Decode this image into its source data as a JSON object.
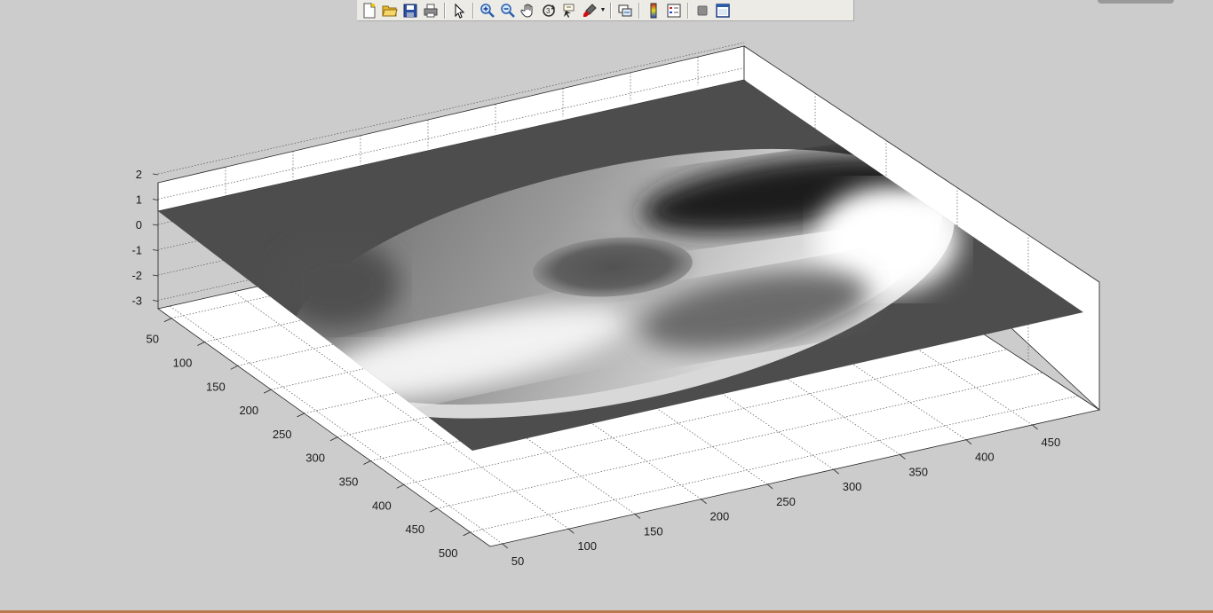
{
  "toolbar": {
    "buttons": [
      {
        "name": "new-figure-button",
        "icon": "new-document-icon"
      },
      {
        "name": "open-file-button",
        "icon": "folder-open-icon"
      },
      {
        "name": "save-figure-button",
        "icon": "floppy-disk-icon"
      },
      {
        "name": "print-figure-button",
        "icon": "printer-icon"
      },
      {
        "name": "edit-plot-button",
        "icon": "pointer-arrow-icon"
      },
      {
        "name": "zoom-in-button",
        "icon": "zoom-in-icon"
      },
      {
        "name": "zoom-out-button",
        "icon": "zoom-out-icon"
      },
      {
        "name": "pan-button",
        "icon": "hand-icon"
      },
      {
        "name": "rotate-3d-button",
        "icon": "rotate-3d-icon"
      },
      {
        "name": "data-cursor-button",
        "icon": "data-cursor-icon"
      },
      {
        "name": "brush-button",
        "icon": "brush-icon"
      },
      {
        "name": "link-plot-button",
        "icon": "link-plot-icon"
      },
      {
        "name": "insert-colorbar-button",
        "icon": "colorbar-icon"
      },
      {
        "name": "insert-legend-button",
        "icon": "legend-icon"
      },
      {
        "name": "hide-plot-tools-button",
        "icon": "hide-tools-icon"
      },
      {
        "name": "show-plot-tools-button",
        "icon": "show-tools-icon"
      }
    ]
  },
  "chart_data": {
    "type": "surface",
    "title": "",
    "xlabel": "",
    "ylabel": "",
    "zlabel": "",
    "z_ticks": [
      "2",
      "1",
      "0",
      "-1",
      "-2",
      "-3"
    ],
    "y_ticks": [
      "50",
      "100",
      "150",
      "200",
      "250",
      "300",
      "350",
      "400",
      "450",
      "500"
    ],
    "x_ticks": [
      "50",
      "100",
      "150",
      "200",
      "250",
      "300",
      "350",
      "400",
      "450"
    ],
    "zlim": [
      -3,
      2
    ],
    "colormap": "gray",
    "grid": true,
    "colors": {
      "background": "#cccccc",
      "axes_face": "#ffffff",
      "grid": "#555555",
      "surface_base": "#4d4d4d"
    }
  }
}
